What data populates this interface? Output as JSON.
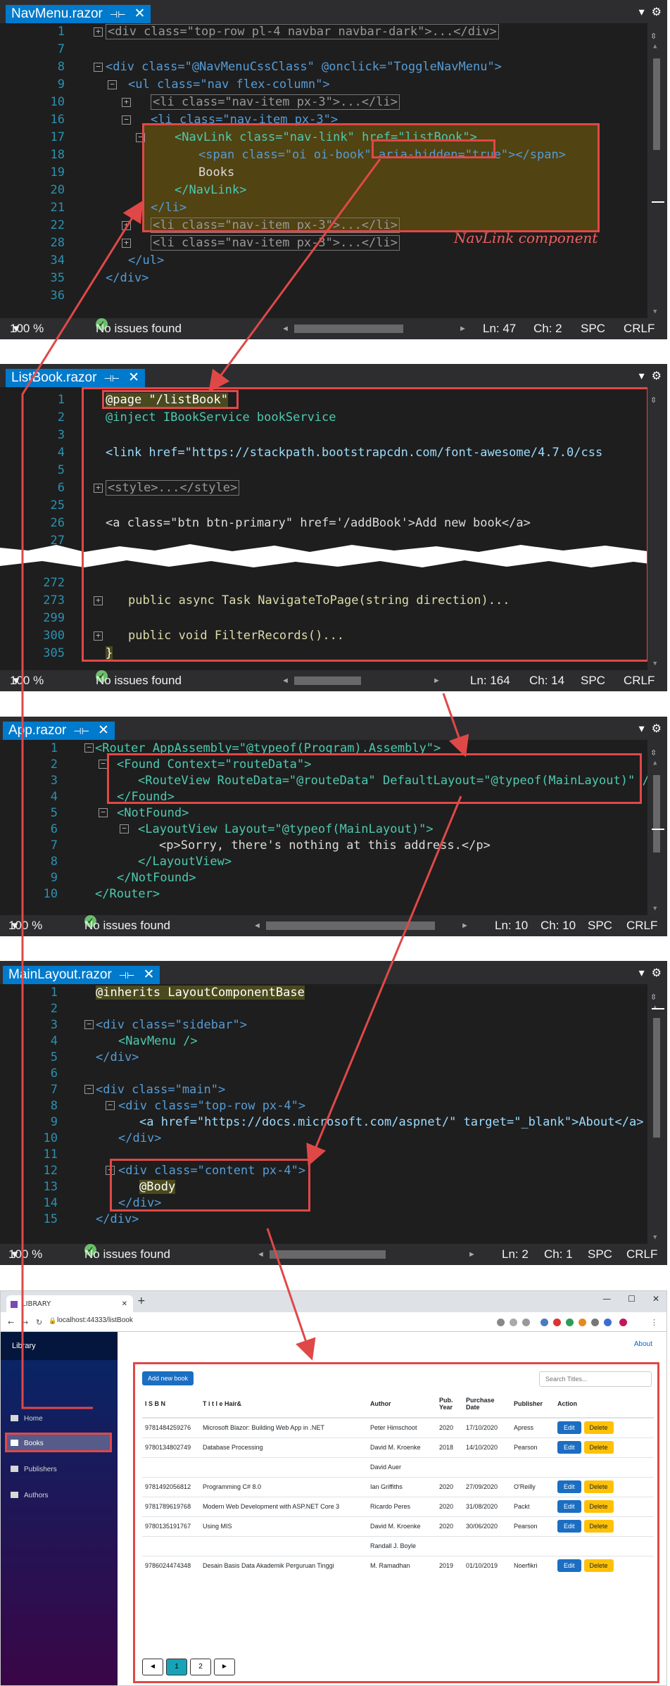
{
  "editors": [
    {
      "tab": "NavMenu.razor",
      "lines": [
        "1",
        "7",
        "8",
        "9",
        "10",
        "16",
        "17",
        "18",
        "19",
        "20",
        "21",
        "22",
        "28",
        "34",
        "35",
        "36"
      ],
      "code": [
        "<div class=\"top-row pl-4 navbar navbar-dark\">...</div>",
        "",
        "<div class=\"@NavMenuCssClass\" @onclick=\"ToggleNavMenu\">",
        "<ul class=\"nav flex-column\">",
        "<li class=\"nav-item px-3\">...</li>",
        "<li class=\"nav-item px-3\">",
        "<NavLink class=\"nav-link\" href=\"listBook\">",
        "<span class=\"oi oi-book\" aria-hidden=\"true\"></span>",
        "Books",
        "</NavLink>",
        "</li>",
        "<li class=\"nav-item px-3\">...</li>",
        "<li class=\"nav-item px-3\">...</li>",
        "</ul>",
        "</div>",
        ""
      ],
      "zoom": "100 %",
      "issues": "No issues found",
      "ln": "Ln: 47",
      "ch": "Ch: 2",
      "spc": "SPC",
      "crlf": "CRLF"
    },
    {
      "tab": "ListBook.razor",
      "lines": [
        "1",
        "2",
        "3",
        "4",
        "5",
        "6",
        "25",
        "26",
        "27",
        "272",
        "273",
        "299",
        "300",
        "305"
      ],
      "code": [
        "@page \"/listBook\"",
        "@inject IBookService bookService",
        "",
        "<link href=\"https://stackpath.bootstrapcdn.com/font-awesome/4.7.0/css",
        "",
        "<style>...</style>",
        "",
        "<a class=\"btn btn-primary\" href='/addBook'>Add new book</a>",
        "",
        "",
        "public async Task NavigateToPage(string direction)...",
        "",
        "public void FilterRecords()...",
        "}"
      ],
      "zoom": "100 %",
      "issues": "No issues found",
      "ln": "Ln: 164",
      "ch": "Ch: 14",
      "spc": "SPC",
      "crlf": "CRLF"
    },
    {
      "tab": "App.razor",
      "lines": [
        "1",
        "2",
        "3",
        "4",
        "5",
        "6",
        "7",
        "8",
        "9",
        "10"
      ],
      "code": [
        "<Router AppAssembly=\"@typeof(Program).Assembly\">",
        "<Found Context=\"routeData\">",
        "<RouteView RouteData=\"@routeData\" DefaultLayout=\"@typeof(MainLayout)\" />",
        "</Found>",
        "<NotFound>",
        "<LayoutView Layout=\"@typeof(MainLayout)\">",
        "<p>Sorry, there's nothing at this address.</p>",
        "</LayoutView>",
        "</NotFound>",
        "</Router>"
      ],
      "zoom": "100 %",
      "issues": "No issues found",
      "ln": "Ln: 10",
      "ch": "Ch: 10",
      "spc": "SPC",
      "crlf": "CRLF"
    },
    {
      "tab": "MainLayout.razor",
      "lines": [
        "1",
        "2",
        "3",
        "4",
        "5",
        "6",
        "7",
        "8",
        "9",
        "10",
        "11",
        "12",
        "13",
        "14",
        "15"
      ],
      "code": [
        "@inherits LayoutComponentBase",
        "",
        "<div class=\"sidebar\">",
        "<NavMenu />",
        "</div>",
        "",
        "<div class=\"main\">",
        "<div class=\"top-row px-4\">",
        "<a href=\"https://docs.microsoft.com/aspnet/\" target=\"_blank\">About</a>",
        "</div>",
        "",
        "<div class=\"content px-4\">",
        "@Body",
        "</div>",
        "</div>"
      ],
      "zoom": "100 %",
      "issues": "No issues found",
      "ln": "Ln: 2",
      "ch": "Ch: 1",
      "spc": "SPC",
      "crlf": "CRLF"
    }
  ],
  "annotation": "NavLink component",
  "browser": {
    "tab_title": "LIBRARY",
    "url": "localhost:44333/listBook",
    "about": "About",
    "brand": "Library",
    "nav": [
      "Home",
      "Books",
      "Publishers",
      "Authors"
    ],
    "add_button": "Add new book",
    "search_placeholder": "Search Titles...",
    "columns": [
      "I S B N",
      "T i t l e Hair&",
      "Author",
      "Pub. Year",
      "Purchase Date",
      "Publisher",
      "Action"
    ],
    "rows": [
      [
        "9781484259276",
        "Microsoft Blazor: Building Web App in .NET",
        "Peter Himschoot",
        "2020",
        "17/10/2020",
        "Apress"
      ],
      [
        "9780134802749",
        "Database Processing",
        "David M. Kroenke",
        "2018",
        "14/10/2020",
        "Pearson"
      ],
      [
        "",
        "",
        "David Auer",
        "",
        "",
        ""
      ],
      [
        "9781492056812",
        "Programming C# 8.0",
        "Ian Griffiths",
        "2020",
        "27/09/2020",
        "O'Reilly"
      ],
      [
        "9781789619768",
        "Modern Web Development with ASP.NET Core 3",
        "Ricardo Peres",
        "2020",
        "31/08/2020",
        "Packt"
      ],
      [
        "9780135191767",
        "Using MIS",
        "David M. Kroenke",
        "2020",
        "30/06/2020",
        "Pearson"
      ],
      [
        "",
        "",
        "Randall J. Boyle",
        "",
        "",
        ""
      ],
      [
        "9786024474348",
        "Desain Basis Data Akademik Perguruan Tinggi",
        "M. Ramadhan",
        "2019",
        "01/10/2019",
        "Noerfikri"
      ]
    ],
    "edit": "Edit",
    "delete": "Delete",
    "pager": [
      "◄",
      "1",
      "2",
      "►"
    ]
  }
}
